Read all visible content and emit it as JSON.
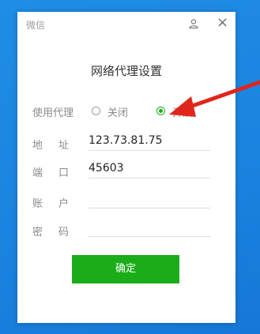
{
  "window": {
    "app_title": "微信"
  },
  "dialog": {
    "title": "网络代理设置",
    "proxy_label": "使用代理",
    "proxy_options": [
      {
        "label": "关闭",
        "selected": false
      },
      {
        "label": "开启",
        "selected": true
      }
    ],
    "fields": [
      {
        "label": "地址",
        "value": "123.73.81.75"
      },
      {
        "label": "端口",
        "value": "45603"
      },
      {
        "label": "账户",
        "value": ""
      },
      {
        "label": "密码",
        "value": ""
      }
    ],
    "confirm_label": "确定"
  },
  "colors": {
    "desktop_blue": "#1a83df",
    "accent_green": "#1aad19",
    "annotation_red": "#e0261c"
  },
  "icons": {
    "top_user": "user-icon",
    "top_close": "close-icon"
  }
}
